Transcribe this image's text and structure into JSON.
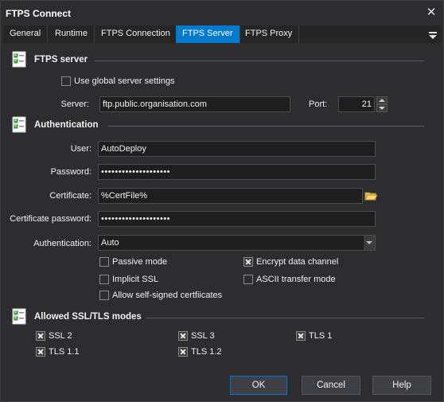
{
  "window": {
    "title": "FTPS Connect",
    "close_glyph": "✕"
  },
  "tabs": [
    {
      "label": "General",
      "active": false
    },
    {
      "label": "Runtime",
      "active": false
    },
    {
      "label": "FTPS Connection",
      "active": false
    },
    {
      "label": "FTPS Server",
      "active": true
    },
    {
      "label": "FTPS Proxy",
      "active": false
    }
  ],
  "server_section": {
    "title": "FTPS server",
    "use_global": {
      "label": "Use global server settings",
      "checked": false
    },
    "server_label": "Server:",
    "server_value": "ftp.public.organisation.com",
    "port_label": "Port:",
    "port_value": "21"
  },
  "auth_section": {
    "title": "Authentication",
    "user_label": "User:",
    "user_value": "AutoDeploy",
    "password_label": "Password:",
    "password_value": "••••••••••••••••••••",
    "certificate_label": "Certificate:",
    "certificate_value": "%CertFile%",
    "cert_password_label": "Certificate password:",
    "cert_password_value": "••••••••••••••••••••",
    "authentication_label": "Authentication:",
    "authentication_value": "Auto",
    "options": {
      "passive_mode": {
        "label": "Passive mode",
        "checked": false
      },
      "encrypt_data": {
        "label": "Encrypt data channel",
        "checked": true
      },
      "implicit_ssl": {
        "label": "Implicit SSL",
        "checked": false
      },
      "ascii_mode": {
        "label": "ASCII transfer mode",
        "checked": false
      },
      "self_signed": {
        "label": "Allow self-signed certfiicates",
        "checked": false
      }
    }
  },
  "modes_section": {
    "title": "Allowed SSL/TLS modes",
    "ssl2": {
      "label": "SSL 2",
      "checked": true
    },
    "ssl3": {
      "label": "SSL 3",
      "checked": true
    },
    "tls1": {
      "label": "TLS 1",
      "checked": true
    },
    "tls11": {
      "label": "TLS 1.1",
      "checked": true
    },
    "tls12": {
      "label": "TLS 1.2",
      "checked": true
    }
  },
  "buttons": {
    "ok": "OK",
    "cancel": "Cancel",
    "help": "Help"
  },
  "colors": {
    "background": "#2d2d30",
    "accent": "#007acc",
    "input_bg": "#1e1e1e",
    "text": "#f1f1f1"
  }
}
